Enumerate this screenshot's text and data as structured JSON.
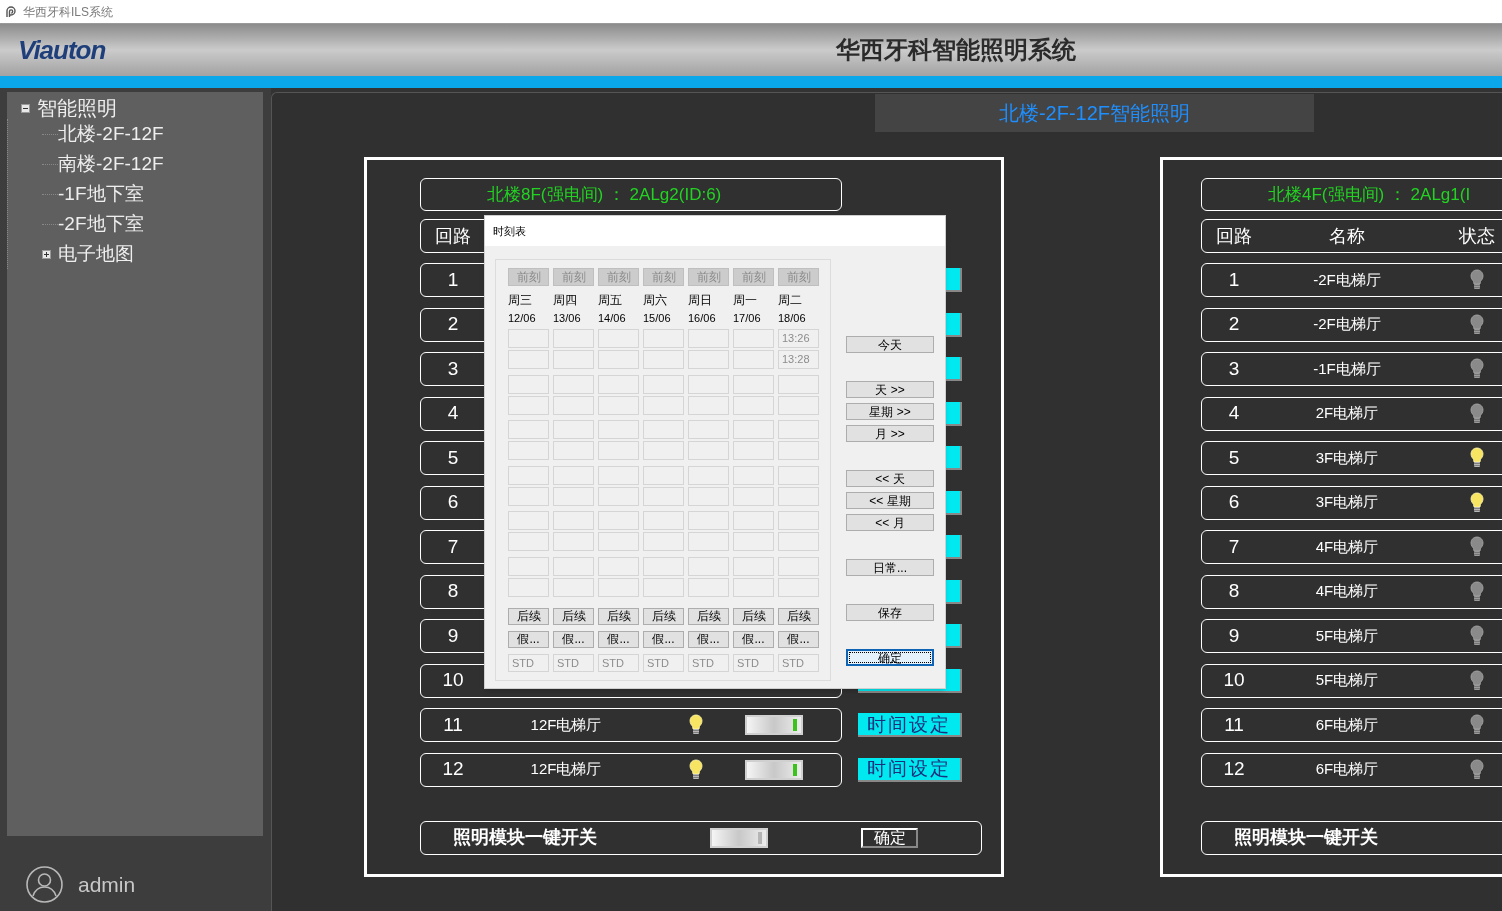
{
  "title_bar": {
    "title": "华西牙科ILS系统"
  },
  "header": {
    "logo": "Viauton",
    "title": "华西牙科智能照明系统"
  },
  "sidebar": {
    "tree": [
      {
        "label": "智能照明",
        "expanded": true,
        "children": [
          {
            "label": "北楼-2F-12F"
          },
          {
            "label": "南楼-2F-12F"
          },
          {
            "label": "-1F地下室"
          },
          {
            "label": "-2F地下室"
          },
          {
            "label": "电子地图",
            "expanded": false
          }
        ]
      }
    ],
    "user": "admin"
  },
  "section_title": "北楼-2F-12F智能照明",
  "panels": [
    {
      "header": "北楼8F(强电间) ： 2ALg2(ID:6)",
      "columns": [
        "回路"
      ],
      "time_buttons": true,
      "rows": [
        {
          "number": "1"
        },
        {
          "number": "2"
        },
        {
          "number": "3"
        },
        {
          "number": "4"
        },
        {
          "number": "5"
        },
        {
          "number": "6"
        },
        {
          "number": "7"
        },
        {
          "number": "8"
        },
        {
          "number": "9"
        },
        {
          "number": "10"
        },
        {
          "number": "11",
          "name": "12F电梯厅",
          "lit": true,
          "switch_on": true,
          "time_button": "时间设定"
        },
        {
          "number": "12",
          "name": "12F电梯厅",
          "lit": true,
          "switch_on": true,
          "time_button": "时间设定"
        }
      ],
      "master": {
        "label": "照明模块一键开关",
        "switch_on": false,
        "button": "确定"
      }
    },
    {
      "header": "北楼4F(强电间) ： 2ALg1(I",
      "columns": [
        "回路",
        "名称",
        "状态"
      ],
      "rows": [
        {
          "number": "1",
          "name": "-2F电梯厅",
          "lit": false
        },
        {
          "number": "2",
          "name": "-2F电梯厅",
          "lit": false
        },
        {
          "number": "3",
          "name": "-1F电梯厅",
          "lit": false
        },
        {
          "number": "4",
          "name": "2F电梯厅",
          "lit": false
        },
        {
          "number": "5",
          "name": "3F电梯厅",
          "lit": true
        },
        {
          "number": "6",
          "name": "3F电梯厅",
          "lit": true
        },
        {
          "number": "7",
          "name": "4F电梯厅",
          "lit": false
        },
        {
          "number": "8",
          "name": "4F电梯厅",
          "lit": false
        },
        {
          "number": "9",
          "name": "5F电梯厅",
          "lit": false
        },
        {
          "number": "10",
          "name": "5F电梯厅",
          "lit": false
        },
        {
          "number": "11",
          "name": "6F电梯厅",
          "lit": false
        },
        {
          "number": "12",
          "name": "6F电梯厅",
          "lit": false
        }
      ],
      "master": {
        "label": "照明模块一键开关"
      }
    }
  ],
  "dialog": {
    "title": "时刻表",
    "days": [
      {
        "prev": "前刻",
        "prev_disabled": true,
        "weekday": "周三",
        "date": "12/06",
        "next": "后续",
        "holiday": "假...",
        "mode": "STD"
      },
      {
        "prev": "前刻",
        "prev_disabled": true,
        "weekday": "周四",
        "date": "13/06",
        "next": "后续",
        "holiday": "假...",
        "mode": "STD"
      },
      {
        "prev": "前刻",
        "prev_disabled": true,
        "weekday": "周五",
        "date": "14/06",
        "next": "后续",
        "holiday": "假...",
        "mode": "STD"
      },
      {
        "prev": "前刻",
        "prev_disabled": true,
        "weekday": "周六",
        "date": "15/06",
        "next": "后续",
        "holiday": "假...",
        "mode": "STD"
      },
      {
        "prev": "前刻",
        "prev_disabled": true,
        "weekday": "周日",
        "date": "16/06",
        "next": "后续",
        "holiday": "假...",
        "mode": "STD"
      },
      {
        "prev": "前刻",
        "prev_disabled": true,
        "weekday": "周一",
        "date": "17/06",
        "next": "后续",
        "holiday": "假...",
        "mode": "STD"
      },
      {
        "prev": "前刻",
        "prev_disabled": true,
        "weekday": "周二",
        "date": "18/06",
        "times": [
          "13:26",
          "13:28"
        ],
        "next": "后续",
        "holiday": "假...",
        "mode": "STD"
      }
    ],
    "nav_groups": [
      [
        {
          "label": "今天",
          "focused": false
        }
      ],
      [
        {
          "label": "天 >>",
          "focused": false
        },
        {
          "label": "星期 >>",
          "focused": false
        },
        {
          "label": "月 >>",
          "focused": false
        }
      ],
      [
        {
          "label": "<< 天",
          "focused": false
        },
        {
          "label": "<< 星期",
          "focused": false
        },
        {
          "label": "<< 月",
          "focused": false
        }
      ],
      [
        {
          "label": "日常...",
          "focused": false
        }
      ],
      [
        {
          "label": "保存",
          "focused": false
        }
      ],
      [
        {
          "label": "确定",
          "focused": true
        }
      ]
    ]
  }
}
